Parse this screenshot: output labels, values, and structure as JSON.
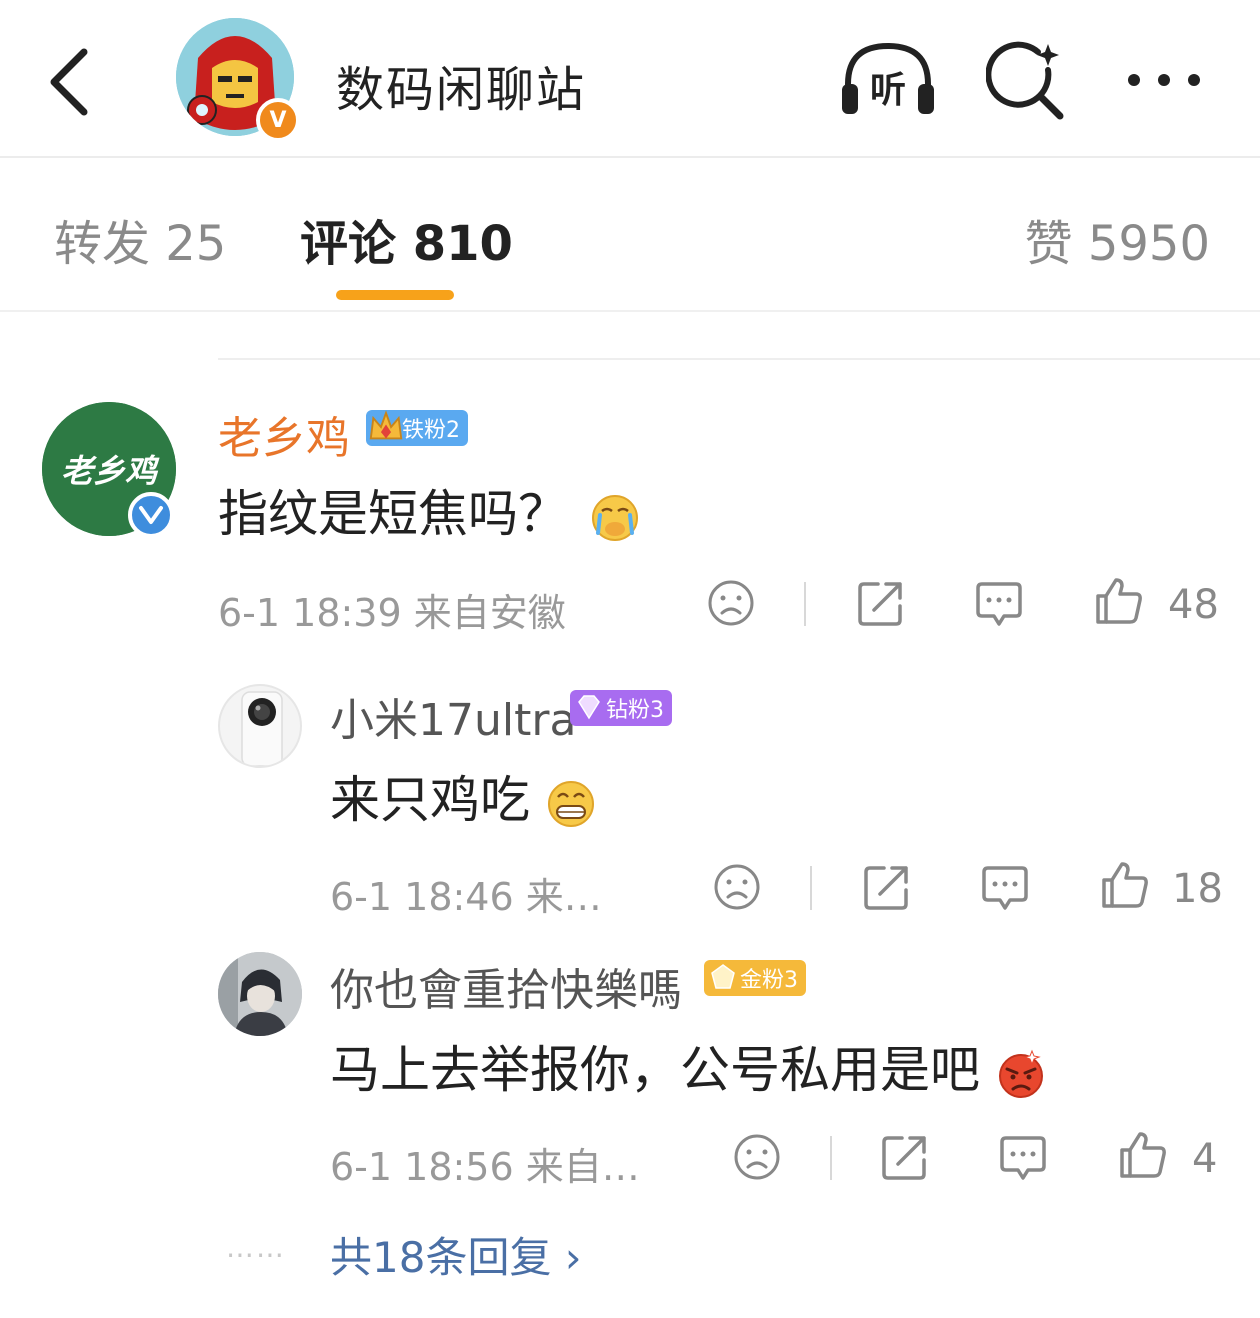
{
  "header": {
    "title": "数码闲聊站",
    "listen_label": "听",
    "avatar_badge": "V"
  },
  "tabs": {
    "repost": "转发 25",
    "comment": "评论 810",
    "like": "赞 5950"
  },
  "comments": [
    {
      "username": "老乡鸡",
      "avatar_text": "老乡鸡",
      "fan_badge": "铁粉2",
      "text": "指纹是短焦吗？",
      "time_location": "6-1 18:39  来自安徽",
      "likes": "48"
    },
    {
      "username": "小米17ultra",
      "fan_badge": "钻粉3",
      "text": "来只鸡吃",
      "time_location": "6-1 18:46  来…",
      "likes": "18"
    },
    {
      "username": "你也會重拾快樂嗎",
      "fan_badge": "金粉3",
      "text": "马上去举报你，公号私用是吧",
      "time_location": "6-1 18:56  来自…",
      "likes": "4"
    }
  ],
  "more_replies": "共18条回复 ›",
  "colors": {
    "accent": "#f7a21a",
    "username_orange": "#e8752a",
    "link_blue": "#4a6fa5",
    "iron_fan": "#5aa9f0",
    "diamond_fan": "#a86cf0",
    "gold_fan": "#f5b93a"
  },
  "icons": [
    "back-arrow-icon",
    "headphones-icon",
    "search-sparkle-icon",
    "more-dots-icon",
    "dislike-face-icon",
    "share-icon",
    "comment-bubble-icon",
    "thumbs-up-icon"
  ]
}
